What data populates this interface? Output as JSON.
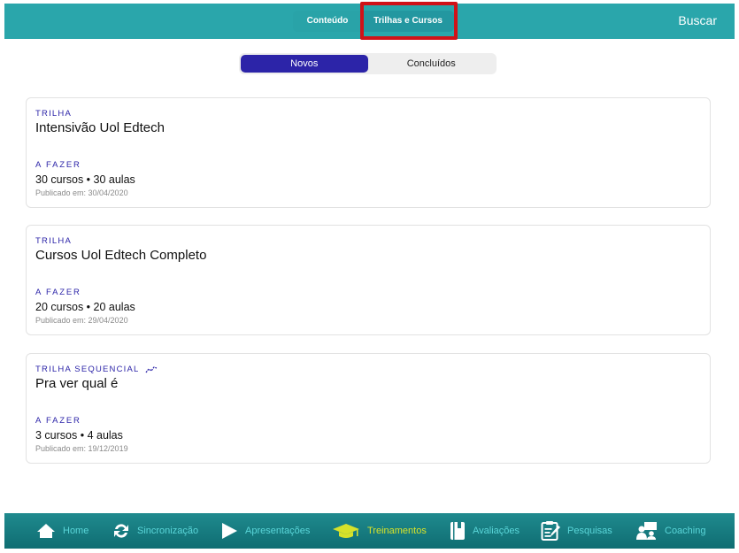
{
  "header": {
    "tabs": [
      {
        "label": "Conteúdo"
      },
      {
        "label": "Trilhas e Cursos"
      }
    ],
    "search_label": "Buscar"
  },
  "filter": {
    "options": [
      {
        "label": "Novos"
      },
      {
        "label": "Concluídos"
      }
    ],
    "selected": "Novos"
  },
  "cards": [
    {
      "kind": "TRILHA",
      "title": "Intensivão Uol Edtech",
      "status": "A FAZER",
      "counts": "30 cursos • 30 aulas",
      "published": "Publicado em: 30/04/2020"
    },
    {
      "kind": "TRILHA",
      "title": "Cursos Uol Edtech Completo",
      "status": "A FAZER",
      "counts": "20 cursos • 20 aulas",
      "published": "Publicado em: 29/04/2020"
    },
    {
      "kind": "TRILHA SEQUENCIAL",
      "kind_icon": "trend-line-icon",
      "title": "Pra ver qual é",
      "status": "A FAZER",
      "counts": "3 cursos • 4 aulas",
      "published": "Publicado em: 19/12/2019"
    }
  ],
  "tabbar": {
    "items": [
      {
        "label": "Home",
        "icon": "home-icon"
      },
      {
        "label": "Sincronização",
        "icon": "sync-icon"
      },
      {
        "label": "Apresentações",
        "icon": "play-icon"
      },
      {
        "label": "Treinamentos",
        "icon": "graduation-cap-icon",
        "active": true
      },
      {
        "label": "Avaliações",
        "icon": "book-icon"
      },
      {
        "label": "Pesquisas",
        "icon": "survey-icon"
      },
      {
        "label": "Coaching",
        "icon": "coaching-icon"
      }
    ]
  },
  "colors": {
    "header": "#2aa6ab",
    "accent": "#2c24a8",
    "highlight": "#d01218",
    "tab_inactive": "#5ad6d9",
    "tab_active": "#d7e22a"
  }
}
